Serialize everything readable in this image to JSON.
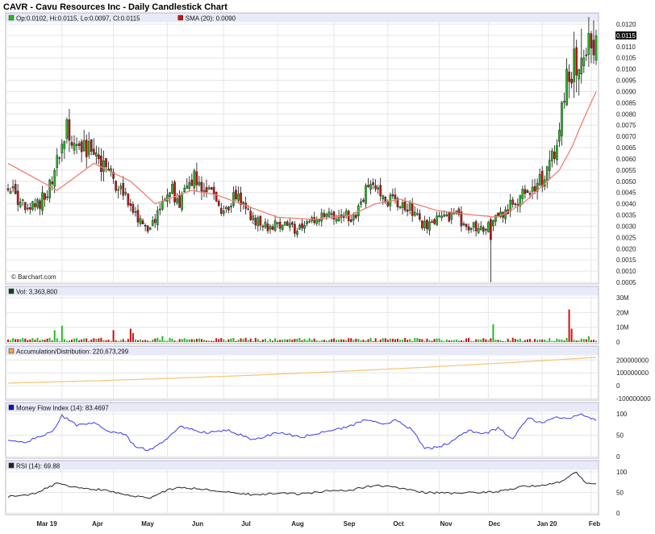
{
  "chart_data": {
    "type": "candlestick",
    "title": "CAVR - Cavu Resources Inc - Daily Candlestick Chart",
    "source_label": "© Barchart.com",
    "x_labels": [
      "Mar 19",
      "Apr",
      "May",
      "Jun",
      "Jul",
      "Aug",
      "Sep",
      "Oct",
      "Nov",
      "Dec",
      "Jan 20",
      "Feb"
    ],
    "colors": {
      "up": "#22bb22",
      "down": "#cc1111",
      "sma": "#f08070",
      "ad": "#f5c77e",
      "mfi": "#3a3aee",
      "rsi": "#222222",
      "grid": "#e6e6e6",
      "panel_header": "#e8eaf8"
    },
    "panels": {
      "price": {
        "legend": [
          {
            "swatch": "#22bb22",
            "text": "Op:0.0102, Hi:0.0115, Lo:0.0097, Cl:0.0115"
          },
          {
            "swatch": "#cc1111",
            "text": "SMA (20): 0.0090"
          }
        ],
        "ylim": [
          0.0005,
          0.012
        ],
        "ticks": [
          "0.0120",
          "0.0115",
          "0.0110",
          "0.0105",
          "0.0100",
          "0.0095",
          "0.0090",
          "0.0085",
          "0.0080",
          "0.0075",
          "0.0070",
          "0.0065",
          "0.0060",
          "0.0055",
          "0.0050",
          "0.0045",
          "0.0040",
          "0.0035",
          "0.0030",
          "0.0025",
          "0.0020",
          "0.0015",
          "0.0010",
          "0.0005"
        ],
        "last_value": "0.0115",
        "anchors": [
          [
            0,
            0.0048
          ],
          [
            8,
            0.0036
          ],
          [
            15,
            0.0043
          ],
          [
            20,
            0.0058
          ],
          [
            24,
            0.0072
          ],
          [
            30,
            0.0064
          ],
          [
            36,
            0.0062
          ],
          [
            42,
            0.0052
          ],
          [
            48,
            0.0044
          ],
          [
            53,
            0.0033
          ],
          [
            57,
            0.0027
          ],
          [
            62,
            0.0037
          ],
          [
            66,
            0.0047
          ],
          [
            70,
            0.004
          ],
          [
            76,
            0.0052
          ],
          [
            82,
            0.0046
          ],
          [
            88,
            0.0037
          ],
          [
            94,
            0.0044
          ],
          [
            100,
            0.0033
          ],
          [
            106,
            0.003
          ],
          [
            112,
            0.0031
          ],
          [
            118,
            0.0028
          ],
          [
            124,
            0.0032
          ],
          [
            130,
            0.0034
          ],
          [
            136,
            0.0035
          ],
          [
            142,
            0.0034
          ],
          [
            148,
            0.005
          ],
          [
            152,
            0.0044
          ],
          [
            158,
            0.004
          ],
          [
            164,
            0.0038
          ],
          [
            170,
            0.003
          ],
          [
            176,
            0.0033
          ],
          [
            182,
            0.0035
          ],
          [
            188,
            0.003
          ],
          [
            194,
            0.003
          ],
          [
            200,
            0.0034
          ],
          [
            204,
            0.0038
          ],
          [
            207,
            0.004
          ],
          [
            210,
            0.0045
          ],
          [
            213,
            0.0047
          ],
          [
            216,
            0.005
          ],
          [
            219,
            0.0052
          ],
          [
            222,
            0.006
          ],
          [
            225,
            0.0072
          ],
          [
            228,
            0.0098
          ],
          [
            231,
            0.0103
          ],
          [
            234,
            0.011
          ],
          [
            237,
            0.0108
          ],
          [
            240,
            0.0115
          ]
        ],
        "sma_anchors": [
          [
            0,
            0.0058
          ],
          [
            20,
            0.0046
          ],
          [
            35,
            0.0058
          ],
          [
            50,
            0.005
          ],
          [
            60,
            0.004
          ],
          [
            75,
            0.0046
          ],
          [
            85,
            0.0044
          ],
          [
            95,
            0.004
          ],
          [
            110,
            0.0034
          ],
          [
            125,
            0.0033
          ],
          [
            140,
            0.0035
          ],
          [
            150,
            0.004
          ],
          [
            160,
            0.0042
          ],
          [
            175,
            0.0037
          ],
          [
            190,
            0.0035
          ],
          [
            200,
            0.0034
          ],
          [
            210,
            0.004
          ],
          [
            220,
            0.005
          ],
          [
            225,
            0.0055
          ],
          [
            230,
            0.0065
          ],
          [
            235,
            0.0078
          ],
          [
            240,
            0.009
          ]
        ],
        "volatility": 0.08,
        "special": [
          {
            "i": 197,
            "low": 0.0005,
            "open": 0.0033,
            "close": 0.0024,
            "high": 0.0034
          },
          {
            "i": 234,
            "high": 0.0118
          },
          {
            "i": 238,
            "high": 0.0117
          }
        ]
      },
      "volume": {
        "legend": [
          {
            "swatch": "#114411",
            "text": "Vol: 3,363,800"
          }
        ],
        "ylim": [
          0,
          30000000
        ],
        "ticks": [
          "30M",
          "20M",
          "10M",
          "0"
        ],
        "base": 1500000,
        "spikes": [
          {
            "i": 19,
            "v": 8000000
          },
          {
            "i": 22,
            "v": 11000000
          },
          {
            "i": 43,
            "v": 8000000
          },
          {
            "i": 50,
            "v": 9000000
          },
          {
            "i": 51,
            "v": 6000000
          },
          {
            "i": 63,
            "v": 4000000
          },
          {
            "i": 198,
            "v": 12000000
          },
          {
            "i": 229,
            "v": 22000000
          },
          {
            "i": 230,
            "v": 9000000
          },
          {
            "i": 237,
            "v": 4000000
          }
        ]
      },
      "accumulation_distribution": {
        "legend": [
          {
            "swatch": "#f5a341",
            "text": "Accumulation/Distribution: 220,673,299"
          }
        ],
        "ylim": [
          -100000000,
          220673299
        ],
        "ticks": [
          "200000000",
          "100000000",
          "0",
          "-100000000"
        ],
        "start": 20000000,
        "end": 220673299
      },
      "mfi": {
        "legend": [
          {
            "swatch": "#1111aa",
            "text": "Money Flow Index (14): 83.4697"
          }
        ],
        "ylim": [
          0,
          100
        ],
        "ticks": [
          "100",
          "50",
          "0"
        ],
        "anchors": [
          [
            0,
            36
          ],
          [
            6,
            32
          ],
          [
            12,
            44
          ],
          [
            18,
            58
          ],
          [
            22,
            96
          ],
          [
            28,
            74
          ],
          [
            35,
            78
          ],
          [
            42,
            58
          ],
          [
            48,
            52
          ],
          [
            52,
            20
          ],
          [
            58,
            16
          ],
          [
            64,
            36
          ],
          [
            70,
            72
          ],
          [
            75,
            64
          ],
          [
            80,
            56
          ],
          [
            90,
            62
          ],
          [
            100,
            40
          ],
          [
            110,
            56
          ],
          [
            120,
            46
          ],
          [
            130,
            58
          ],
          [
            140,
            72
          ],
          [
            146,
            88
          ],
          [
            152,
            76
          ],
          [
            158,
            84
          ],
          [
            165,
            62
          ],
          [
            170,
            18
          ],
          [
            176,
            22
          ],
          [
            182,
            38
          ],
          [
            188,
            62
          ],
          [
            194,
            52
          ],
          [
            200,
            66
          ],
          [
            206,
            42
          ],
          [
            212,
            90
          ],
          [
            218,
            78
          ],
          [
            224,
            92
          ],
          [
            230,
            90
          ],
          [
            234,
            100
          ],
          [
            240,
            84
          ]
        ]
      },
      "rsi": {
        "legend": [
          {
            "swatch": "#222222",
            "text": "RSI (14): 69.88"
          }
        ],
        "ylim": [
          0,
          100
        ],
        "ticks": [
          "100",
          "50",
          "0"
        ],
        "anchors": [
          [
            0,
            40
          ],
          [
            10,
            46
          ],
          [
            20,
            72
          ],
          [
            30,
            60
          ],
          [
            40,
            56
          ],
          [
            50,
            42
          ],
          [
            58,
            36
          ],
          [
            66,
            58
          ],
          [
            72,
            62
          ],
          [
            80,
            58
          ],
          [
            90,
            52
          ],
          [
            100,
            44
          ],
          [
            110,
            48
          ],
          [
            120,
            46
          ],
          [
            130,
            54
          ],
          [
            140,
            56
          ],
          [
            150,
            68
          ],
          [
            160,
            60
          ],
          [
            170,
            50
          ],
          [
            180,
            48
          ],
          [
            190,
            50
          ],
          [
            200,
            52
          ],
          [
            206,
            60
          ],
          [
            212,
            66
          ],
          [
            220,
            68
          ],
          [
            226,
            76
          ],
          [
            232,
            100
          ],
          [
            236,
            70
          ],
          [
            240,
            72
          ]
        ]
      }
    }
  }
}
